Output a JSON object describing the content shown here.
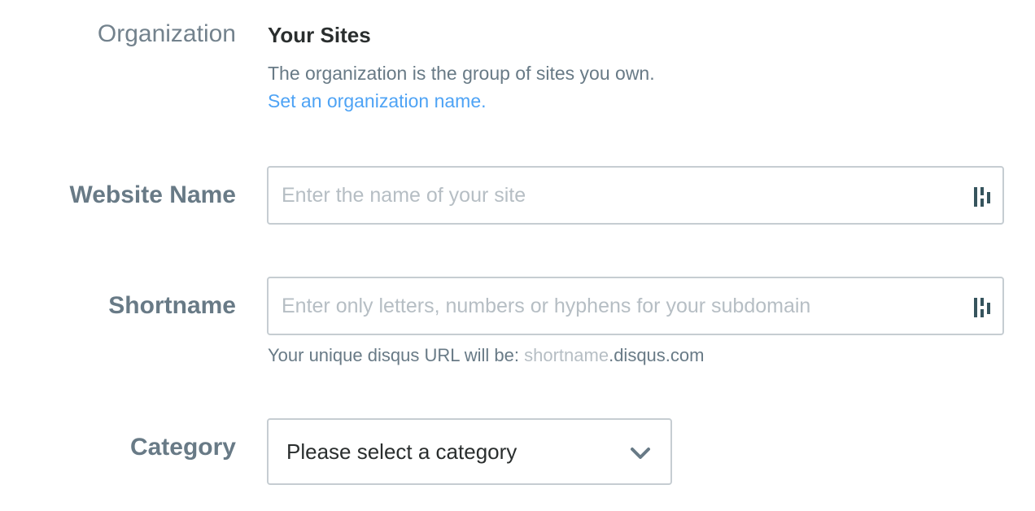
{
  "organization": {
    "label": "Organization",
    "title": "Your Sites",
    "description": "The organization is the group of sites you own.",
    "link_text": "Set an organization name."
  },
  "website_name": {
    "label": "Website Name",
    "placeholder": "Enter the name of your site",
    "value": "",
    "icon": "password-manager-icon"
  },
  "shortname": {
    "label": "Shortname",
    "placeholder": "Enter only letters, numbers or hyphens for your subdomain",
    "value": "",
    "icon": "password-manager-icon",
    "hint_prefix": "Your unique disqus URL will be: ",
    "hint_shortname": "shortname",
    "hint_domain": ".disqus.com"
  },
  "category": {
    "label": "Category",
    "selected": "Please select a category",
    "icon": "chevron-down-icon"
  },
  "colors": {
    "label": "#687a86",
    "link": "#4ea3f5",
    "border": "#c6cdd2",
    "placeholder": "#b6bec4",
    "text": "#2a2e2e"
  }
}
